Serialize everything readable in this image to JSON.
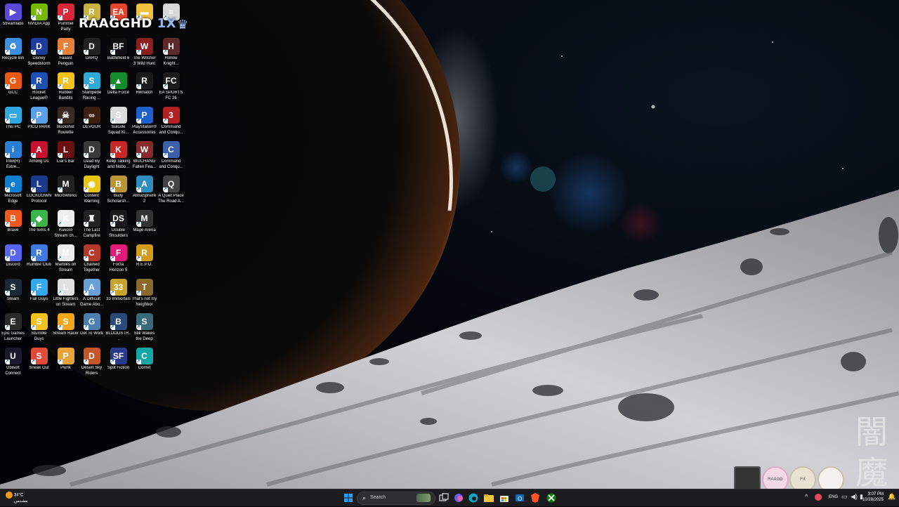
{
  "overlay": {
    "brand": "RAAGGHD",
    "suffix": "1X"
  },
  "kanji": [
    "闇",
    "魔"
  ],
  "desktop_icons": [
    {
      "label": "Streamlabs",
      "color": "#5b4ad8",
      "glyph": "▶"
    },
    {
      "label": "NVIDIA App",
      "color": "#76b900",
      "glyph": "N"
    },
    {
      "label": "Pummel Party",
      "color": "#d9263a",
      "glyph": "P"
    },
    {
      "label": "",
      "color": "#c9b23e",
      "glyph": "R"
    },
    {
      "label": "",
      "color": "#e8432b",
      "glyph": "EA"
    },
    {
      "label": "",
      "color": "#f0c040",
      "glyph": "▬"
    },
    {
      "label": "",
      "color": "#d8d8d8",
      "glyph": "≡"
    },
    {
      "label": "Recycle Bin",
      "color": "#3e8ee0",
      "glyph": "♻"
    },
    {
      "label": "Disney Speedstorm",
      "color": "#1c3d9e",
      "glyph": "D"
    },
    {
      "label": "Faaast Penguin",
      "color": "#e4813a",
      "glyph": "F"
    },
    {
      "label": "DARQ",
      "color": "#222",
      "glyph": "D"
    },
    {
      "label": "Battlefield 6",
      "color": "#111",
      "glyph": "BF"
    },
    {
      "label": "The Witcher 3 Wild Hunt",
      "color": "#8b1e1e",
      "glyph": "W"
    },
    {
      "label": "Hollow Knight...",
      "color": "#5e2a2a",
      "glyph": "H"
    },
    {
      "label": "GCC",
      "color": "#e65a12",
      "glyph": "G"
    },
    {
      "label": "Rocket League®",
      "color": "#1e4fb5",
      "glyph": "R"
    },
    {
      "label": "Rubber Bandits",
      "color": "#f2c21c",
      "glyph": "R"
    },
    {
      "label": "Stampede Racing ...",
      "color": "#2fa9d6",
      "glyph": "S"
    },
    {
      "label": "Delta Force",
      "color": "#138c2e",
      "glyph": "▲"
    },
    {
      "label": "Rematch",
      "color": "#1a1a1a",
      "glyph": "R"
    },
    {
      "label": "EA SPORTS FC 26",
      "color": "#1b1b1b",
      "glyph": "FC"
    },
    {
      "label": "This PC",
      "color": "#2fa7e0",
      "glyph": "▭"
    },
    {
      "label": "PICO PARK",
      "color": "#5aa0e8",
      "glyph": "P"
    },
    {
      "label": "Buckshot Roulette",
      "color": "#3a2a22",
      "glyph": "☠"
    },
    {
      "label": "DEVOUR",
      "color": "#3c1f10",
      "glyph": "∞"
    },
    {
      "label": "Suicide Squad Ki...",
      "color": "#ddd",
      "glyph": "S"
    },
    {
      "label": "PlayStation® Accessories",
      "color": "#1f5fc9",
      "glyph": "P"
    },
    {
      "label": "Command and Conqu...",
      "color": "#b22222",
      "glyph": "3"
    },
    {
      "label": "Intel(R) Extre...",
      "color": "#2a7fd4",
      "glyph": "i"
    },
    {
      "label": "Among Us",
      "color": "#c8102e",
      "glyph": "A"
    },
    {
      "label": "Liar's Bar",
      "color": "#6a1010",
      "glyph": "L"
    },
    {
      "label": "Dead By Daylight",
      "color": "#3a3a3a",
      "glyph": "D"
    },
    {
      "label": "Keep Talking and Nobo...",
      "color": "#c62828",
      "glyph": "K"
    },
    {
      "label": "WUCHANG Fallen Fea...",
      "color": "#8a2b2b",
      "glyph": "W"
    },
    {
      "label": "Command and Conqu...",
      "color": "#3b5fa8",
      "glyph": "C"
    },
    {
      "label": "Microsoft Edge",
      "color": "#0c7fd3",
      "glyph": "e"
    },
    {
      "label": "LOCKDOWN Protocol",
      "color": "#1b3a8c",
      "glyph": "L"
    },
    {
      "label": "MicroWorks",
      "color": "#222",
      "glyph": "M"
    },
    {
      "label": "Content Warning",
      "color": "#e8c60f",
      "glyph": "◉"
    },
    {
      "label": "Bully Scholarsh...",
      "color": "#b99536",
      "glyph": "B"
    },
    {
      "label": "AtmaSphere 2",
      "color": "#2e8fbf",
      "glyph": "A"
    },
    {
      "label": "A Quiet Place The Road A...",
      "color": "#444",
      "glyph": "Q"
    },
    {
      "label": "Brave",
      "color": "#f25a1d",
      "glyph": "B"
    },
    {
      "label": "The Sims 4",
      "color": "#3bb54a",
      "glyph": "◆"
    },
    {
      "label": "Kukoro Stream ch...",
      "color": "#eee",
      "glyph": "K"
    },
    {
      "label": "The Last Campfire",
      "color": "#222",
      "glyph": "♜"
    },
    {
      "label": "Double Shoulders",
      "color": "#1a1a1a",
      "glyph": "DS"
    },
    {
      "label": "Mage Arena",
      "color": "#333",
      "glyph": "M"
    },
    null,
    {
      "label": "Discord",
      "color": "#5865f2",
      "glyph": "D"
    },
    {
      "label": "Rumble Club",
      "color": "#3f7ae0",
      "glyph": "R"
    },
    {
      "label": "Marbles on Stream",
      "color": "#ececec",
      "glyph": "M"
    },
    {
      "label": "Chained Together",
      "color": "#b33a2b",
      "glyph": "C"
    },
    {
      "label": "Forza Horizon 5",
      "color": "#e6197a",
      "glyph": "F"
    },
    {
      "label": "R.E.P.O.",
      "color": "#d39b1c",
      "glyph": "R"
    },
    null,
    {
      "label": "Steam",
      "color": "#1b2838",
      "glyph": "S"
    },
    {
      "label": "Fall Guys",
      "color": "#35a9f0",
      "glyph": "F"
    },
    {
      "label": "Little Fighters on Stream",
      "color": "#e0e0e0",
      "glyph": "L"
    },
    {
      "label": "A Difficult Game Abo...",
      "color": "#6aa0d8",
      "glyph": "A"
    },
    {
      "label": "33 Immortals",
      "color": "#c7a52a",
      "glyph": "33"
    },
    {
      "label": "That's not my Neighbor",
      "color": "#8a6a2a",
      "glyph": "T"
    },
    null,
    {
      "label": "Epic Games Launcher",
      "color": "#2a2a2a",
      "glyph": "E"
    },
    {
      "label": "Stumble Guys",
      "color": "#f2c31b",
      "glyph": "S"
    },
    {
      "label": "Stream Racer",
      "color": "#f0a81a",
      "glyph": "S"
    },
    {
      "label": "Get To Work",
      "color": "#4a7fb0",
      "glyph": "G"
    },
    {
      "label": "BLOODSTR...",
      "color": "#2a4a7a",
      "glyph": "B"
    },
    {
      "label": "Still Wakes the Deep",
      "color": "#3a6a7a",
      "glyph": "S"
    },
    null,
    {
      "label": "Ubisoft Connect",
      "color": "#1a1a2e",
      "glyph": "U"
    },
    {
      "label": "Sneak Out",
      "color": "#e24a3a",
      "glyph": "S"
    },
    {
      "label": "Pwnk",
      "color": "#e8a23a",
      "glyph": "P"
    },
    {
      "label": "Desert Sky Riders",
      "color": "#c4562a",
      "glyph": "D"
    },
    {
      "label": "Split Fiction",
      "color": "#2a3a8a",
      "glyph": "SF"
    },
    {
      "label": "Comet",
      "color": "#14a5a5",
      "glyph": "C"
    },
    null
  ],
  "widgets": [
    {
      "name": "folder-widget",
      "text": ""
    },
    {
      "name": "vtuber-badge-1",
      "text": "RAAGG"
    },
    {
      "name": "vtuber-badge-2",
      "text": "FX"
    },
    {
      "name": "vtuber-badge-3",
      "text": ""
    }
  ],
  "taskbar": {
    "weather_temp": "34°C",
    "weather_desc": "مشمس",
    "search_placeholder": "Search",
    "language": "ENG",
    "time": "3:07 PM",
    "date": "10/28/2025",
    "colors": {
      "bg": "#1c1c1f",
      "accent": "#0a84ff"
    },
    "pinned_apps": [
      "task-view",
      "copilot",
      "edge",
      "file-explorer",
      "microsoft-store",
      "outlook",
      "brave",
      "xbox"
    ]
  }
}
